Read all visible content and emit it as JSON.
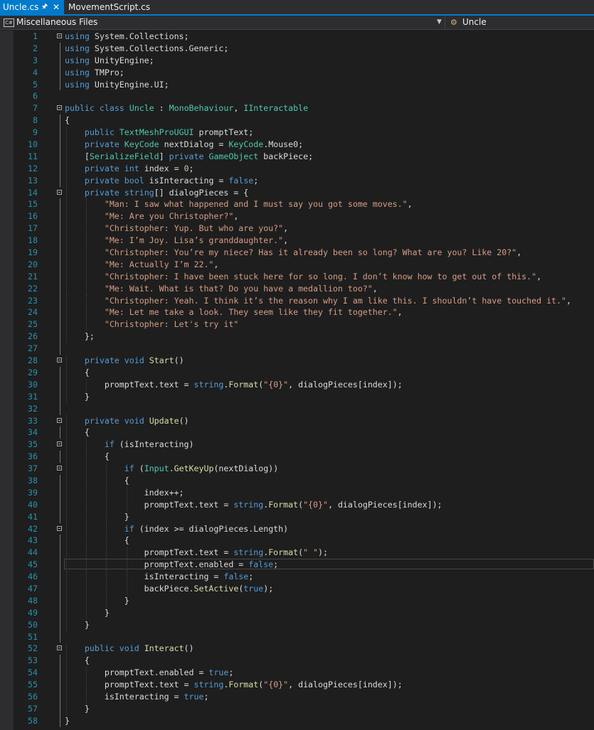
{
  "tabs": [
    {
      "label": "Uncle.cs",
      "active": true,
      "pinned": true
    },
    {
      "label": "MovementScript.cs",
      "active": false
    }
  ],
  "nav": {
    "project": "Miscellaneous Files",
    "class_scope": "Uncle",
    "project_icon": "csharp-file-icon",
    "class_icon": "class-member-icon"
  },
  "editor": {
    "cursor_line": 45,
    "lines": [
      [
        [
          "kw",
          "using"
        ],
        [
          " System.Collections;"
        ]
      ],
      [
        [
          "kw",
          "using"
        ],
        [
          " System.Collections.Generic;"
        ]
      ],
      [
        [
          "kw",
          "using"
        ],
        [
          " UnityEngine;"
        ]
      ],
      [
        [
          "kw",
          "using"
        ],
        [
          " TMPro;"
        ]
      ],
      [
        [
          "kw",
          "using"
        ],
        [
          " UnityEngine.UI;"
        ]
      ],
      [],
      [
        [
          "kw",
          "public"
        ],
        [
          " "
        ],
        [
          "kw",
          "class"
        ],
        [
          " "
        ],
        [
          "ty",
          "Uncle"
        ],
        [
          " : "
        ],
        [
          "ty",
          "MonoBehaviour"
        ],
        [
          ", "
        ],
        [
          "ty",
          "IInteractable"
        ]
      ],
      [
        [
          "{"
        ]
      ],
      [
        [
          "    "
        ],
        [
          "kw",
          "public"
        ],
        [
          " "
        ],
        [
          "ty",
          "TextMeshProUGUI"
        ],
        [
          " promptText;"
        ]
      ],
      [
        [
          "    "
        ],
        [
          "kw",
          "private"
        ],
        [
          " "
        ],
        [
          "ty",
          "KeyCode"
        ],
        [
          " nextDialog = "
        ],
        [
          "ty",
          "KeyCode"
        ],
        [
          ".Mouse0;"
        ]
      ],
      [
        [
          "    ["
        ],
        [
          "ty",
          "SerializeField"
        ],
        [
          "] "
        ],
        [
          "kw",
          "private"
        ],
        [
          " "
        ],
        [
          "ty",
          "GameObject"
        ],
        [
          " backPiece;"
        ]
      ],
      [
        [
          "    "
        ],
        [
          "kw",
          "private"
        ],
        [
          " "
        ],
        [
          "kw",
          "int"
        ],
        [
          " index = "
        ],
        [
          "nu",
          "0"
        ],
        [
          ";"
        ]
      ],
      [
        [
          "    "
        ],
        [
          "kw",
          "private"
        ],
        [
          " "
        ],
        [
          "kw",
          "bool"
        ],
        [
          " isInteracting = "
        ],
        [
          "kw",
          "false"
        ],
        [
          ";"
        ]
      ],
      [
        [
          "    "
        ],
        [
          "kw",
          "private"
        ],
        [
          " "
        ],
        [
          "kw",
          "string"
        ],
        [
          "[] dialogPieces = {"
        ]
      ],
      [
        [
          "        "
        ],
        [
          "st",
          "\"Man: I saw what happened and I must say you got some moves.\""
        ],
        [
          ","
        ]
      ],
      [
        [
          "        "
        ],
        [
          "st",
          "\"Me: Are you Christopher?\""
        ],
        [
          ","
        ]
      ],
      [
        [
          "        "
        ],
        [
          "st",
          "\"Christopher: Yup. But who are you?\""
        ],
        [
          ","
        ]
      ],
      [
        [
          "        "
        ],
        [
          "st",
          "\"Me: I’m Joy. Lisa’s granddaughter.\""
        ],
        [
          ","
        ]
      ],
      [
        [
          "        "
        ],
        [
          "st",
          "\"Christopher: You’re my niece? Has it already been so long? What are you? Like 20?\""
        ],
        [
          ","
        ]
      ],
      [
        [
          "        "
        ],
        [
          "st",
          "\"Me: Actually I’m 22.\""
        ],
        [
          ","
        ]
      ],
      [
        [
          "        "
        ],
        [
          "st",
          "\"Christopher: I have been stuck here for so long. I don’t know how to get out of this.\""
        ],
        [
          ","
        ]
      ],
      [
        [
          "        "
        ],
        [
          "st",
          "\"Me: Wait. What is that? Do you have a medallion too?\""
        ],
        [
          ","
        ]
      ],
      [
        [
          "        "
        ],
        [
          "st",
          "\"Christopher: Yeah. I think it’s the reason why I am like this. I shouldn’t have touched it.\""
        ],
        [
          ","
        ]
      ],
      [
        [
          "        "
        ],
        [
          "st",
          "\"Me: Let me take a look. They seem like they fit together.\""
        ],
        [
          ","
        ]
      ],
      [
        [
          "        "
        ],
        [
          "st",
          "\"Christopher: Let's try it\""
        ]
      ],
      [
        [
          "    };"
        ]
      ],
      [],
      [
        [
          "    "
        ],
        [
          "kw",
          "private"
        ],
        [
          " "
        ],
        [
          "kw",
          "void"
        ],
        [
          " "
        ],
        [
          "fn",
          "Start"
        ],
        [
          "()"
        ]
      ],
      [
        [
          "    {"
        ]
      ],
      [
        [
          "        promptText.text = "
        ],
        [
          "kw",
          "string"
        ],
        [
          "."
        ],
        [
          "fn",
          "Format"
        ],
        [
          "("
        ],
        [
          "st",
          "\"{0}\""
        ],
        [
          ", dialogPieces[index]);"
        ]
      ],
      [
        [
          "    }"
        ]
      ],
      [],
      [
        [
          "    "
        ],
        [
          "kw",
          "private"
        ],
        [
          " "
        ],
        [
          "kw",
          "void"
        ],
        [
          " "
        ],
        [
          "fn",
          "Update"
        ],
        [
          "()"
        ]
      ],
      [
        [
          "    {"
        ]
      ],
      [
        [
          "        "
        ],
        [
          "kw",
          "if"
        ],
        [
          " (isInteracting)"
        ]
      ],
      [
        [
          "        {"
        ]
      ],
      [
        [
          "            "
        ],
        [
          "kw",
          "if"
        ],
        [
          " ("
        ],
        [
          "ty",
          "Input"
        ],
        [
          "."
        ],
        [
          "fn",
          "GetKeyUp"
        ],
        [
          "(nextDialog))"
        ]
      ],
      [
        [
          "            {"
        ]
      ],
      [
        [
          "                index++;"
        ]
      ],
      [
        [
          "                promptText.text = "
        ],
        [
          "kw",
          "string"
        ],
        [
          "."
        ],
        [
          "fn",
          "Format"
        ],
        [
          "("
        ],
        [
          "st",
          "\"{0}\""
        ],
        [
          ", dialogPieces[index]);"
        ]
      ],
      [
        [
          "            }"
        ]
      ],
      [
        [
          "            "
        ],
        [
          "kw",
          "if"
        ],
        [
          " (index >= dialogPieces.Length)"
        ]
      ],
      [
        [
          "            {"
        ]
      ],
      [
        [
          "                promptText.text = "
        ],
        [
          "kw",
          "string"
        ],
        [
          "."
        ],
        [
          "fn",
          "Format"
        ],
        [
          "("
        ],
        [
          "st",
          "\" \""
        ],
        [
          ");"
        ]
      ],
      [
        [
          "                promptText.enabled = "
        ],
        [
          "kw",
          "false"
        ],
        [
          ";"
        ]
      ],
      [
        [
          "                isInteracting = "
        ],
        [
          "kw",
          "false"
        ],
        [
          ";"
        ]
      ],
      [
        [
          "                backPiece."
        ],
        [
          "fn",
          "SetActive"
        ],
        [
          "("
        ],
        [
          "kw",
          "true"
        ],
        [
          ");"
        ]
      ],
      [
        [
          "            }"
        ]
      ],
      [
        [
          "        }"
        ]
      ],
      [
        [
          "    }"
        ]
      ],
      [],
      [
        [
          "    "
        ],
        [
          "kw",
          "public"
        ],
        [
          " "
        ],
        [
          "kw",
          "void"
        ],
        [
          " "
        ],
        [
          "fn",
          "Interact"
        ],
        [
          "()"
        ]
      ],
      [
        [
          "    {"
        ]
      ],
      [
        [
          "        promptText.enabled = "
        ],
        [
          "kw",
          "true"
        ],
        [
          ";"
        ]
      ],
      [
        [
          "        promptText.text = "
        ],
        [
          "kw",
          "string"
        ],
        [
          "."
        ],
        [
          "fn",
          "Format"
        ],
        [
          "("
        ],
        [
          "st",
          "\"{0}\""
        ],
        [
          ", dialogPieces[index]);"
        ]
      ],
      [
        [
          "        isInteracting = "
        ],
        [
          "kw",
          "true"
        ],
        [
          ";"
        ]
      ],
      [
        [
          "    }"
        ]
      ],
      [
        [
          "}"
        ]
      ]
    ]
  }
}
